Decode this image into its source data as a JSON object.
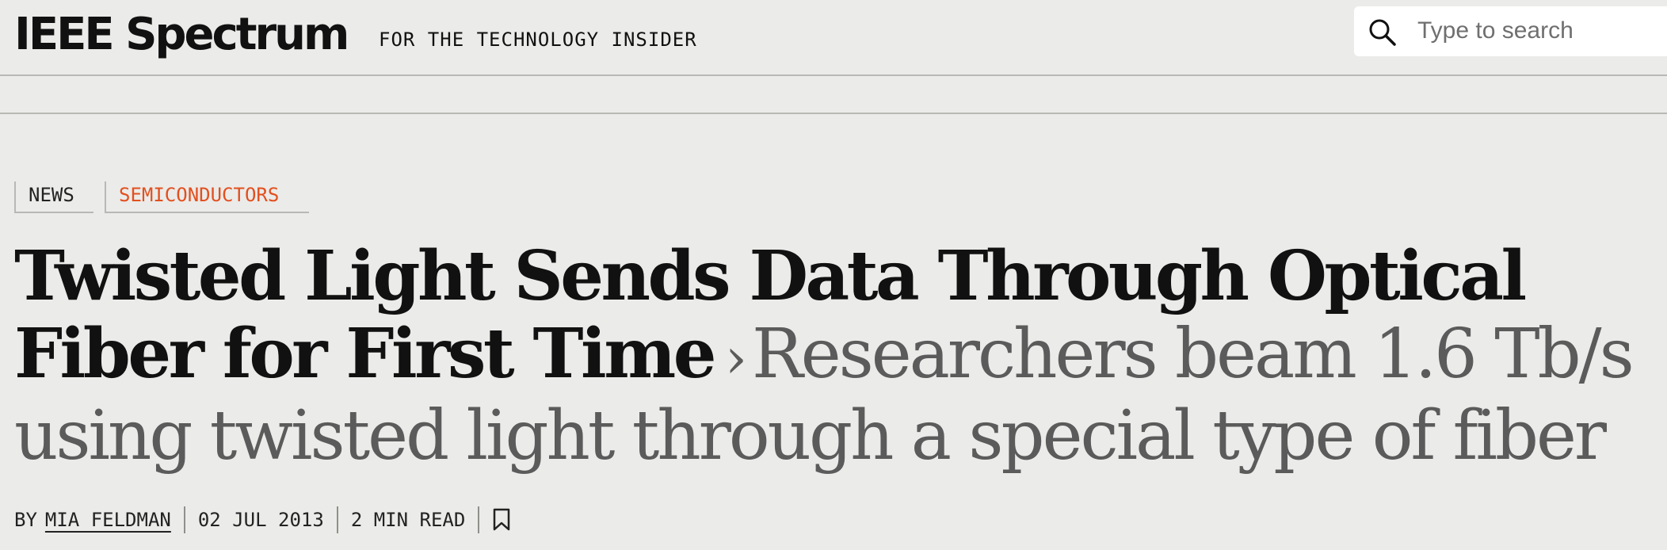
{
  "header": {
    "logo": "IEEE Spectrum",
    "tagline": "FOR THE TECHNOLOGY INSIDER",
    "search": {
      "placeholder": "Type to search",
      "value": "",
      "icon": "search-icon"
    }
  },
  "tags": {
    "type": "NEWS",
    "section": "SEMICONDUCTORS",
    "section_color": "#e2501f"
  },
  "headline": {
    "title": "Twisted Light Sends Data Through Optical Fiber for First Time",
    "separator": "›",
    "dek": "Researchers beam 1.6 Tb/s using twisted light through a special type of fiber"
  },
  "byline": {
    "by": "BY",
    "author": "MIA FELDMAN",
    "date": "02 JUL 2013",
    "read_time": "2 MIN READ",
    "bookmark_icon": "bookmark-icon"
  }
}
